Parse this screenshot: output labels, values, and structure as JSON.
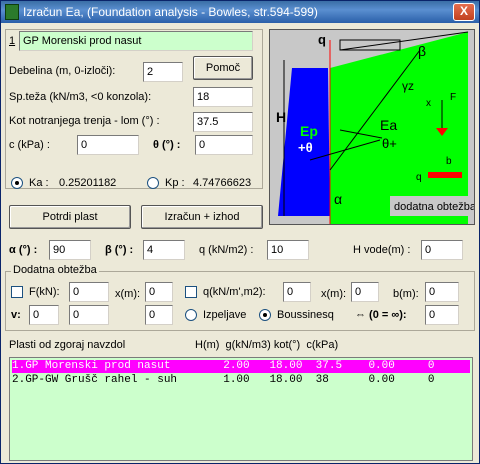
{
  "window": {
    "title": "Izračun Ea, (Foundation analysis - Bowles, str.594-599)",
    "close": "X"
  },
  "layer": {
    "index": "1",
    "name": "GP Morenski prod nasut",
    "debelina_label": "Debelina (m, 0-izloči):",
    "debelina_value": "2",
    "pomoc_label": "Pomoč",
    "spteza_label": "Sp.teža (kN/m3, <0 konzola):",
    "spteza_value": "18",
    "kot_label": "Kot notranjega trenja - lom (°) :",
    "kot_value": "37.5",
    "c_label": "c (kPa) :",
    "c_value": "0",
    "theta_label": "θ (°) :",
    "theta_value": "0"
  },
  "coefficients": {
    "ka_label": "Ka :",
    "ka_value": "0.25201182",
    "kp_label": "Kp :",
    "kp_value": "4.74766623"
  },
  "buttons": {
    "potrdi": "Potrdi plast",
    "izracun": "Izračun + izhod"
  },
  "params": {
    "alpha_label": "α (°) :",
    "alpha_value": "90",
    "beta_label": "β (°) :",
    "beta_value": "4",
    "q_label": "q (kN/m2) :",
    "q_value": "10",
    "hvode_label": "H vode(m) :",
    "hvode_value": "0"
  },
  "dodatna": {
    "title": "Dodatna obtežba",
    "f_label": "F(kN):",
    "f_value": "0",
    "x1_label": "x(m):",
    "x1_value": "0",
    "q_label": "q(kN/m',m2):",
    "q_value": "0",
    "x2_label": "x(m):",
    "x2_value": "0",
    "b_label": "b(m):",
    "b_value": "0",
    "v_label": "v:",
    "v_value1": "0",
    "v_value2": "0",
    "v_value3": "0",
    "izpeljave_label": "Izpeljave",
    "boussinesq_label": "Boussinesq",
    "equiv_label": "⇔ (0 = ∞):",
    "equiv_value": "0"
  },
  "table": {
    "header_title": "Plasti od zgoraj navzdol",
    "header_cols": "H(m)  g(kN/m3) kot(°)  c(kPa)",
    "rows": [
      "1.GP Morenski prod nasut        2.00   18.00  37.5    0.00     0",
      "2.GP-GW Grušč rahel - suh       1.00   18.00  38      0.00     0"
    ]
  },
  "diagram": {
    "q": "q",
    "beta": "β",
    "gamma_z": "γz",
    "h": "H",
    "ep": "Ep",
    "plus_theta": "+θ",
    "ea": "Ea",
    "theta_plus": "θ+",
    "alpha": "α",
    "f": "F",
    "x": "x",
    "b": "b",
    "q_small": "q",
    "dodatna": "dodatna obtežba"
  },
  "colors": {
    "accent_green": "#00ff00",
    "wall_blue": "#0000ff",
    "highlight": "#ff00ff",
    "list_bg": "#ccffcc"
  }
}
